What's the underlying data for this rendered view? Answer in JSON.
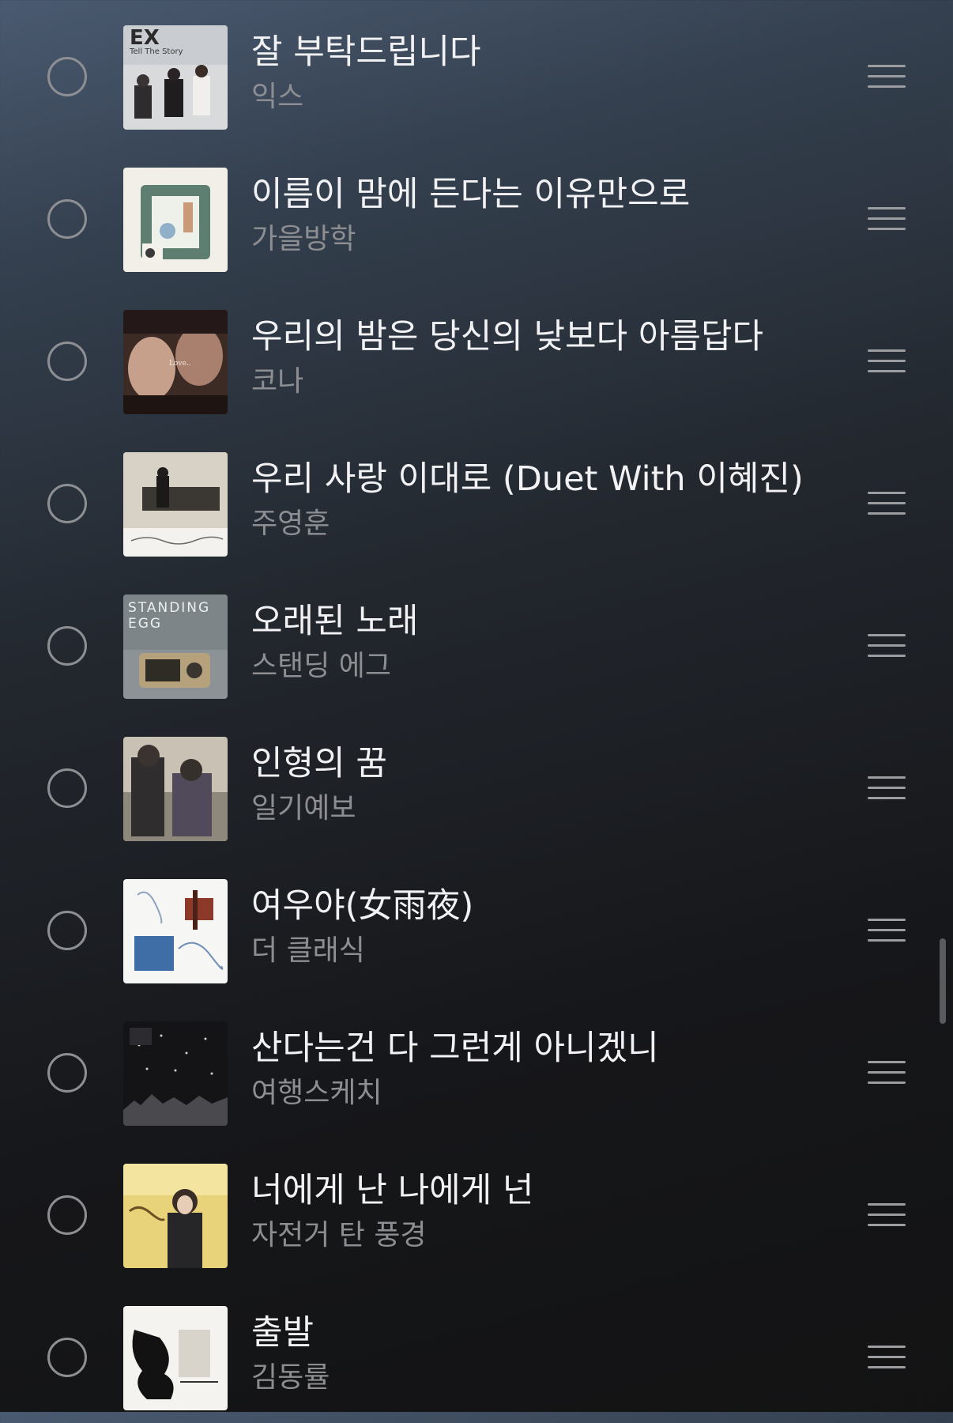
{
  "songs": [
    {
      "title": "잘 부탁드립니다",
      "artist": "익스",
      "art_text": "EX",
      "art_subtext": "Tell The Story"
    },
    {
      "title": "이름이 맘에 든다는 이유만으로",
      "artist": "가을방학",
      "art_text": "",
      "art_subtext": ""
    },
    {
      "title": "우리의 밤은 당신의 낮보다 아름답다",
      "artist": "코나",
      "art_text": "Love..",
      "art_subtext": ""
    },
    {
      "title": "우리 사랑 이대로 (Duet With 이혜진)",
      "artist": "주영훈",
      "art_text": "",
      "art_subtext": ""
    },
    {
      "title": "오래된 노래",
      "artist": "스탠딩 에그",
      "art_text": "STANDING",
      "art_subtext": "EGG"
    },
    {
      "title": "인형의 꿈",
      "artist": "일기예보",
      "art_text": "",
      "art_subtext": ""
    },
    {
      "title": "여우야(女雨夜)",
      "artist": "더 클래식",
      "art_text": "",
      "art_subtext": ""
    },
    {
      "title": "산다는건 다 그런게 아니겠니",
      "artist": "여행스케치",
      "art_text": "",
      "art_subtext": ""
    },
    {
      "title": "너에게 난 나에게 넌",
      "artist": "자전거 탄 풍경",
      "art_text": "",
      "art_subtext": ""
    },
    {
      "title": "출발",
      "artist": "김동률",
      "art_text": "",
      "art_subtext": ""
    }
  ],
  "icons": {
    "select": "circle-outline-icon",
    "reorder": "drag-handle-icon"
  },
  "colors": {
    "title_text": "#f2f2f4",
    "artist_text": "#8d8e92",
    "control_gray": "#9c9da1"
  }
}
